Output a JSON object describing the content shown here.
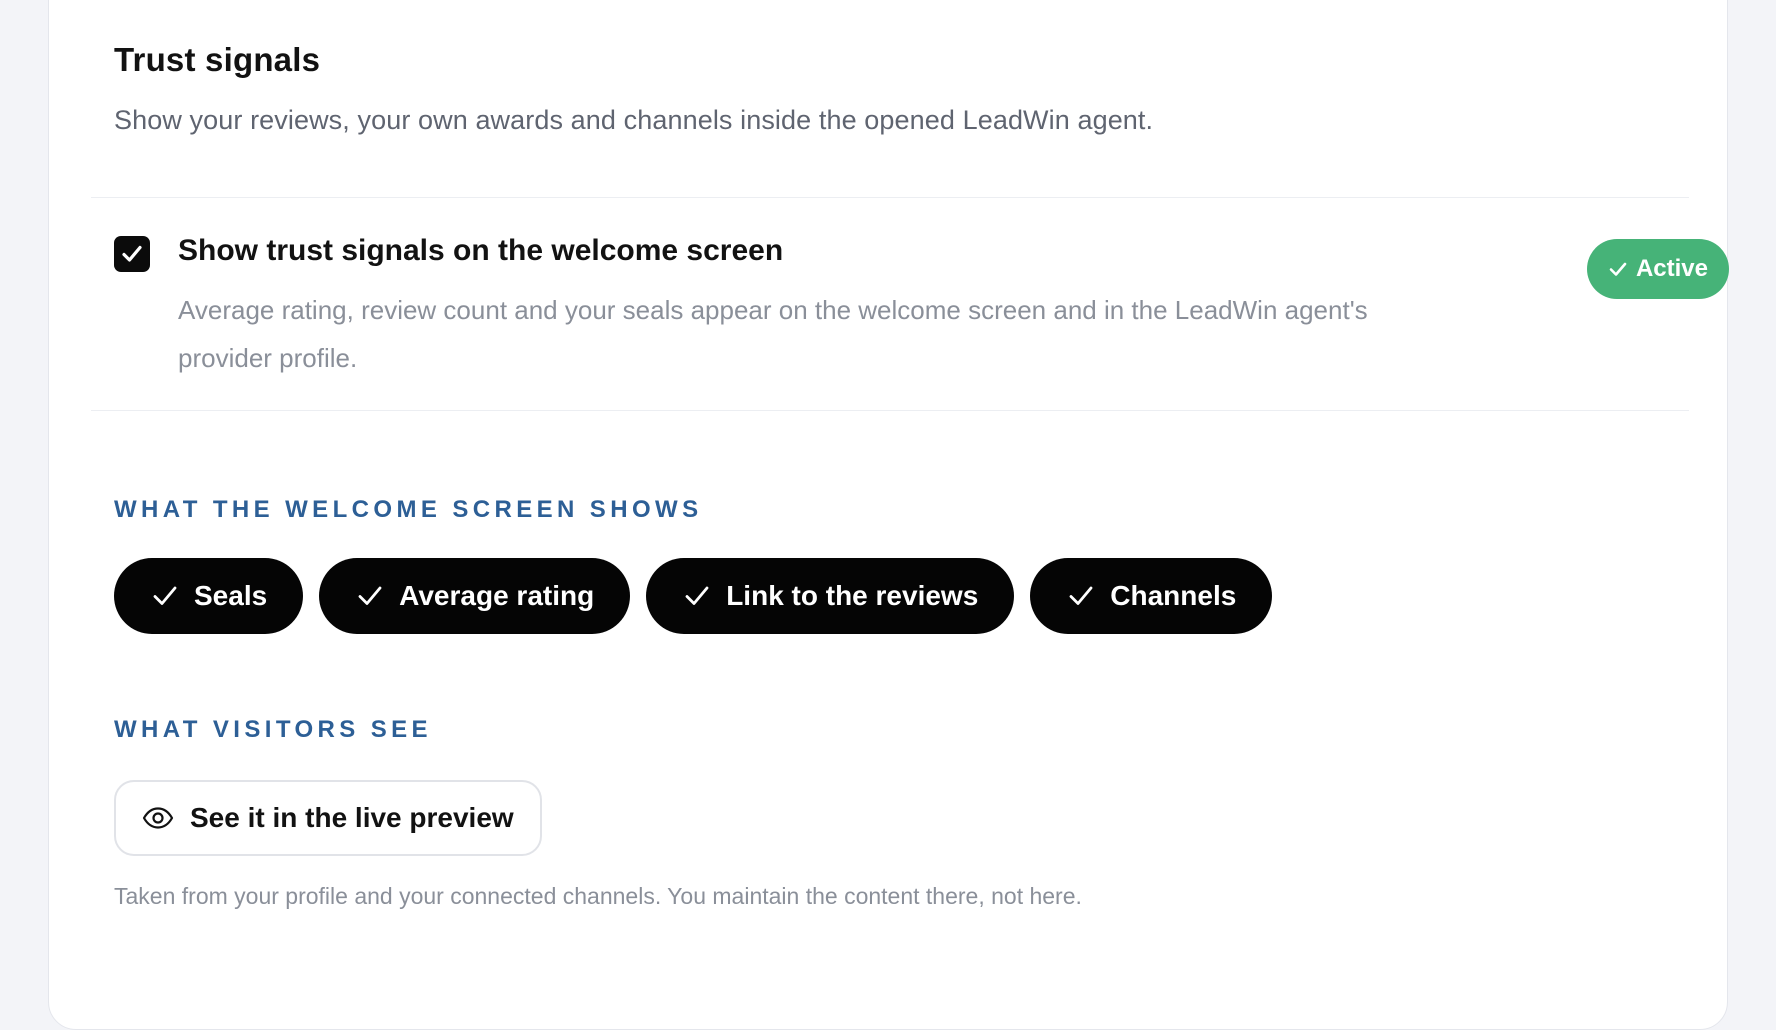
{
  "card": {
    "title": "Trust signals",
    "subtitle": "Show your reviews, your own awards and channels inside the opened LeadWin agent."
  },
  "toggle": {
    "checked": true,
    "label": "Show trust signals on the welcome screen",
    "description": "Average rating, review count and your seals appear on the welcome screen and in the LeadWin agent's provider profile.",
    "status": "Active",
    "status_color": "#46b378"
  },
  "welcome_section": {
    "label": "WHAT THE WELCOME SCREEN SHOWS",
    "chips": [
      {
        "label": "Seals",
        "selected": true
      },
      {
        "label": "Average rating",
        "selected": true
      },
      {
        "label": "Link to the reviews",
        "selected": true
      },
      {
        "label": "Channels",
        "selected": true
      }
    ]
  },
  "visitors_section": {
    "label": "WHAT VISITORS SEE",
    "preview_button": "See it in the live preview",
    "preview_icon": "eye-icon",
    "footnote": "Taken from your profile and your connected channels. You maintain the content there, not here."
  },
  "colors": {
    "section_label": "#2d5f96",
    "chip_bg": "#050505",
    "background": "#f3f4f8"
  }
}
